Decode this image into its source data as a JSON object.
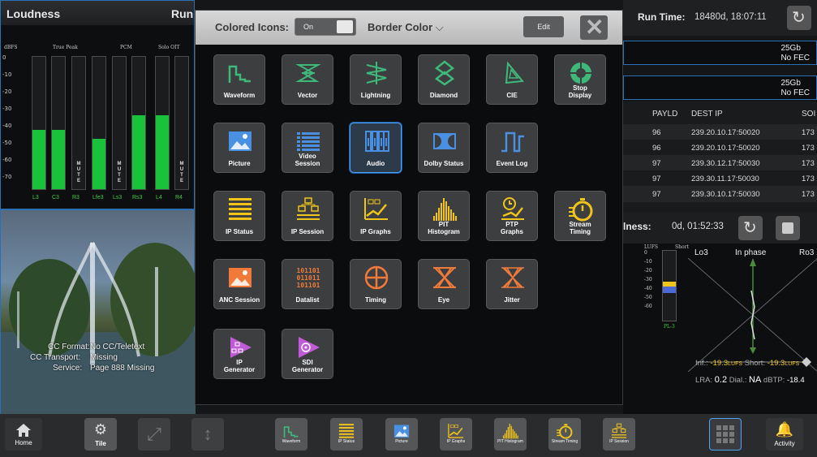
{
  "loudness": {
    "title": "Loudness",
    "run": "Run",
    "headers": [
      "dBFS",
      "True Peak",
      "PCM",
      "Solo OIT"
    ],
    "ticks": [
      "0",
      "-10",
      "-20",
      "-30",
      "-40",
      "-50",
      "-60",
      "-70"
    ],
    "channels": [
      "L3",
      "C3",
      "R3",
      "Lfe3",
      "Ls3",
      "Rs3",
      "L4",
      "R4"
    ],
    "levels": [
      0.45,
      0.45,
      0.0,
      0.38,
      0.0,
      0.56,
      0.56,
      0.0
    ],
    "mute": "M\nU\nT\nE"
  },
  "video": {
    "cc_format_label": "CC Format:",
    "cc_format": "No CC/Teletext",
    "cc_transport_label": "CC Transport:",
    "cc_transport": "Missing",
    "service_label": "Service:",
    "service": "Page 888 Missing"
  },
  "right": {
    "runtime_label": "Run Time:",
    "runtime": "18480d, 18:07:11",
    "row1": "25Gb\nNo FEC",
    "row2": "25Gb\nNo FEC",
    "cols": [
      "PAYLD",
      "DEST IP",
      "SOI"
    ],
    "rows": [
      [
        "96",
        "239.20.10.17:50020",
        "173"
      ],
      [
        "96",
        "239.20.10.17:50020",
        "173"
      ],
      [
        "97",
        "239.30.12.17:50030",
        "173"
      ],
      [
        "97",
        "239.30.11.17:50030",
        "173"
      ],
      [
        "97",
        "239.30.10.17:50030",
        "173"
      ]
    ],
    "stat_label": "lness:",
    "stat_value": "0d, 01:52:33",
    "lufs": "LUFS",
    "short": "Short",
    "lo3": "Lo3",
    "inphase": "In phase",
    "ro3": "Ro3",
    "lticks": [
      "0",
      "-10",
      "-20",
      "-30",
      "-40",
      "-50",
      "-60"
    ],
    "pl": "PL-3",
    "infl": "Inf.:",
    "inf": "-19.3",
    "shortl": "Short:",
    "shortv": "-19.3",
    "lufs2": "LUFS",
    "lra": "LRA:",
    "lrav": "0.2",
    "dial": "Dial.:",
    "dialv": "NA",
    "dbtp": "dBTP:",
    "dbtpv": "-18.4"
  },
  "overlay": {
    "colored_icons": "Colored Icons:",
    "toggle": "On",
    "border_color": "Border Color",
    "edit": "Edit",
    "tiles": [
      {
        "label": "Waveform",
        "icon": "waveform",
        "c": "#3fb97a"
      },
      {
        "label": "Vector",
        "icon": "vector",
        "c": "#3fb97a"
      },
      {
        "label": "Lightning",
        "icon": "lightning",
        "c": "#3fb97a"
      },
      {
        "label": "Diamond",
        "icon": "diamond",
        "c": "#3fb97a"
      },
      {
        "label": "CIE",
        "icon": "cie",
        "c": "#3fb97a"
      },
      {
        "label": "Stop\nDisplay",
        "icon": "stop",
        "c": "#3fb97a"
      },
      {
        "label": "Picture",
        "icon": "picture",
        "c": "#4a90e2"
      },
      {
        "label": "Video\nSession",
        "icon": "list",
        "c": "#4a90e2"
      },
      {
        "label": "Audio",
        "icon": "audio",
        "c": "#4a90e2"
      },
      {
        "label": "Dolby Status",
        "icon": "dolby",
        "c": "#4a90e2"
      },
      {
        "label": "Event Log",
        "icon": "eventlog",
        "c": "#4a90e2"
      },
      {
        "label": "IP Status",
        "icon": "ipstatus",
        "c": "#f0c419"
      },
      {
        "label": "IP Session",
        "icon": "ipsession",
        "c": "#f0c419"
      },
      {
        "label": "IP Graphs",
        "icon": "ipgraphs",
        "c": "#f0c419"
      },
      {
        "label": "PIT\nHistogram",
        "icon": "histogram",
        "c": "#f0c419"
      },
      {
        "label": "PTP\nGraphs",
        "icon": "ptp",
        "c": "#f0c419"
      },
      {
        "label": "Stream\nTiming",
        "icon": "stopwatch",
        "c": "#f0c419"
      },
      {
        "label": "ANC Session",
        "icon": "picture",
        "c": "#f07a3a"
      },
      {
        "label": "Datalist",
        "icon": "datalist",
        "c": "#f07a3a"
      },
      {
        "label": "Timing",
        "icon": "timing",
        "c": "#f07a3a"
      },
      {
        "label": "Eye",
        "icon": "eye",
        "c": "#f07a3a"
      },
      {
        "label": "Jitter",
        "icon": "jitter",
        "c": "#f07a3a"
      },
      {
        "label": "IP\nGenerator",
        "icon": "generator",
        "c": "#c05bd8"
      },
      {
        "label": "SDI\nGenerator",
        "icon": "sdigen",
        "c": "#c05bd8"
      }
    ],
    "datalist_text": "101101\n011011\n101101"
  },
  "dock": {
    "home": "Home",
    "tile": "Tile",
    "activity": "Activity",
    "apps": [
      "Waveform",
      "IP Status",
      "Picture",
      "IP Graphs",
      "PIT Histogram",
      "Stream Timing",
      "IP Session"
    ]
  },
  "colors": {
    "accent": "#2b6fb5",
    "meter_green": "#19c23a",
    "ltext": "#f0c419"
  }
}
